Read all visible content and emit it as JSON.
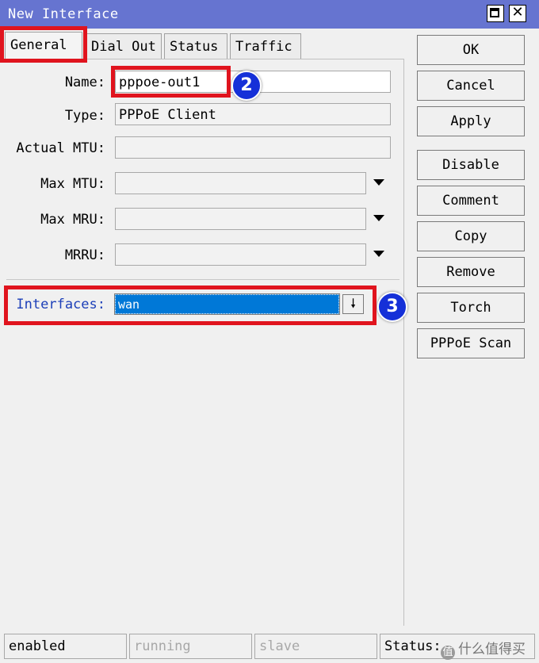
{
  "window": {
    "title": "New Interface",
    "maximize_label": "",
    "close_label": "✕"
  },
  "tabs": [
    "General",
    "Dial Out",
    "Status",
    "Traffic"
  ],
  "fields": {
    "name": {
      "label": "Name:",
      "value": "pppoe-out1"
    },
    "type": {
      "label": "Type:",
      "value": "PPPoE Client"
    },
    "actual_mtu": {
      "label": "Actual MTU:",
      "value": ""
    },
    "max_mtu": {
      "label": "Max MTU:",
      "value": ""
    },
    "max_mru": {
      "label": "Max MRU:",
      "value": ""
    },
    "mrru": {
      "label": "MRRU:",
      "value": ""
    },
    "interfaces": {
      "label": "Interfaces:",
      "value": "wan",
      "button": "🠗"
    }
  },
  "annotations": {
    "badge_2": "2",
    "badge_3": "3"
  },
  "buttons": [
    "OK",
    "Cancel",
    "Apply",
    "Disable",
    "Comment",
    "Copy",
    "Remove",
    "Torch",
    "PPPoE Scan"
  ],
  "statusbar": {
    "state": "enabled",
    "running": "running",
    "slave": "slave",
    "status_label": "Status:"
  },
  "watermark": {
    "logo": "值",
    "text": "什么值得买"
  },
  "colors": {
    "titlebar": "#6674d0",
    "highlight": "#e0141e",
    "badge": "#1530d8",
    "selection": "#0078d7",
    "interfaces_label": "#1c3fb8"
  }
}
